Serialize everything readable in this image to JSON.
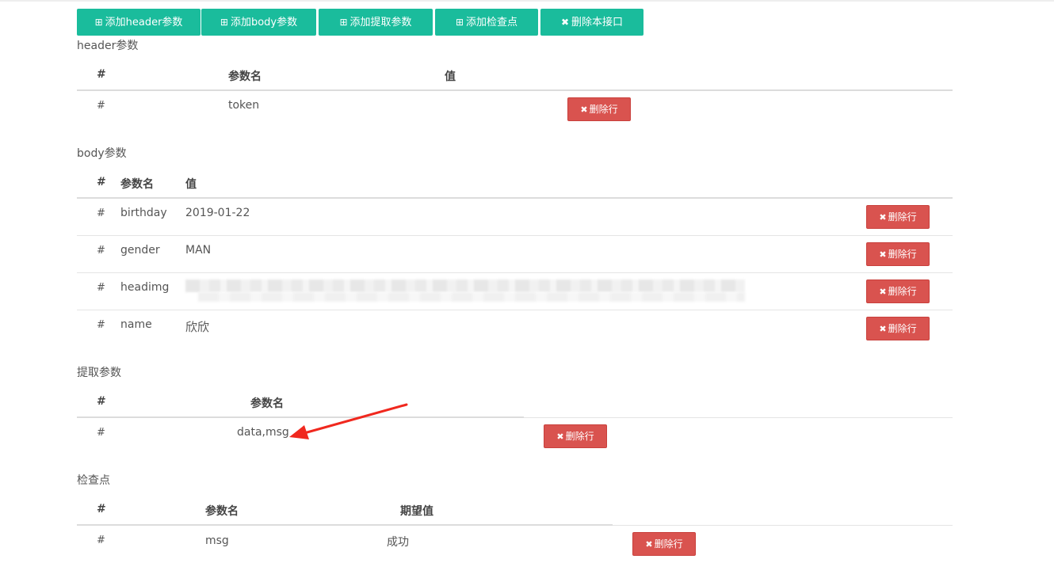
{
  "toolbar": {
    "add_header": "添加header参数",
    "add_body": "添加body参数",
    "add_extract": "添加提取参数",
    "add_check": "添加检查点",
    "delete_api": "删除本接口"
  },
  "icons": {
    "add": "plus-square-icon",
    "delete": "x-icon",
    "add_glyph": "⊞",
    "delete_glyph": "✖"
  },
  "colors": {
    "primary_green": "#1abc9c",
    "danger_red": "#d9534f"
  },
  "delete_row_label": "删除行",
  "header_section": {
    "title": "header参数",
    "columns": [
      "#",
      "参数名",
      "值"
    ],
    "rows": [
      {
        "index": "#",
        "name": "token",
        "value": ""
      }
    ]
  },
  "body_section": {
    "title": "body参数",
    "columns": [
      "#",
      "参数名",
      "值"
    ],
    "rows": [
      {
        "index": "#",
        "name": "birthday",
        "value": "2019-01-22"
      },
      {
        "index": "#",
        "name": "gender",
        "value": "MAN"
      },
      {
        "index": "#",
        "name": "headimg",
        "value": ""
      },
      {
        "index": "#",
        "name": "name",
        "value": "欣欣"
      }
    ]
  },
  "extract_section": {
    "title": "提取参数",
    "columns": [
      "#",
      "参数名"
    ],
    "rows": [
      {
        "index": "#",
        "name": "data,msg"
      }
    ]
  },
  "check_section": {
    "title": "检查点",
    "columns": [
      "#",
      "参数名",
      "期望值"
    ],
    "rows": [
      {
        "index": "#",
        "name": "msg",
        "expected": "成功"
      }
    ]
  }
}
